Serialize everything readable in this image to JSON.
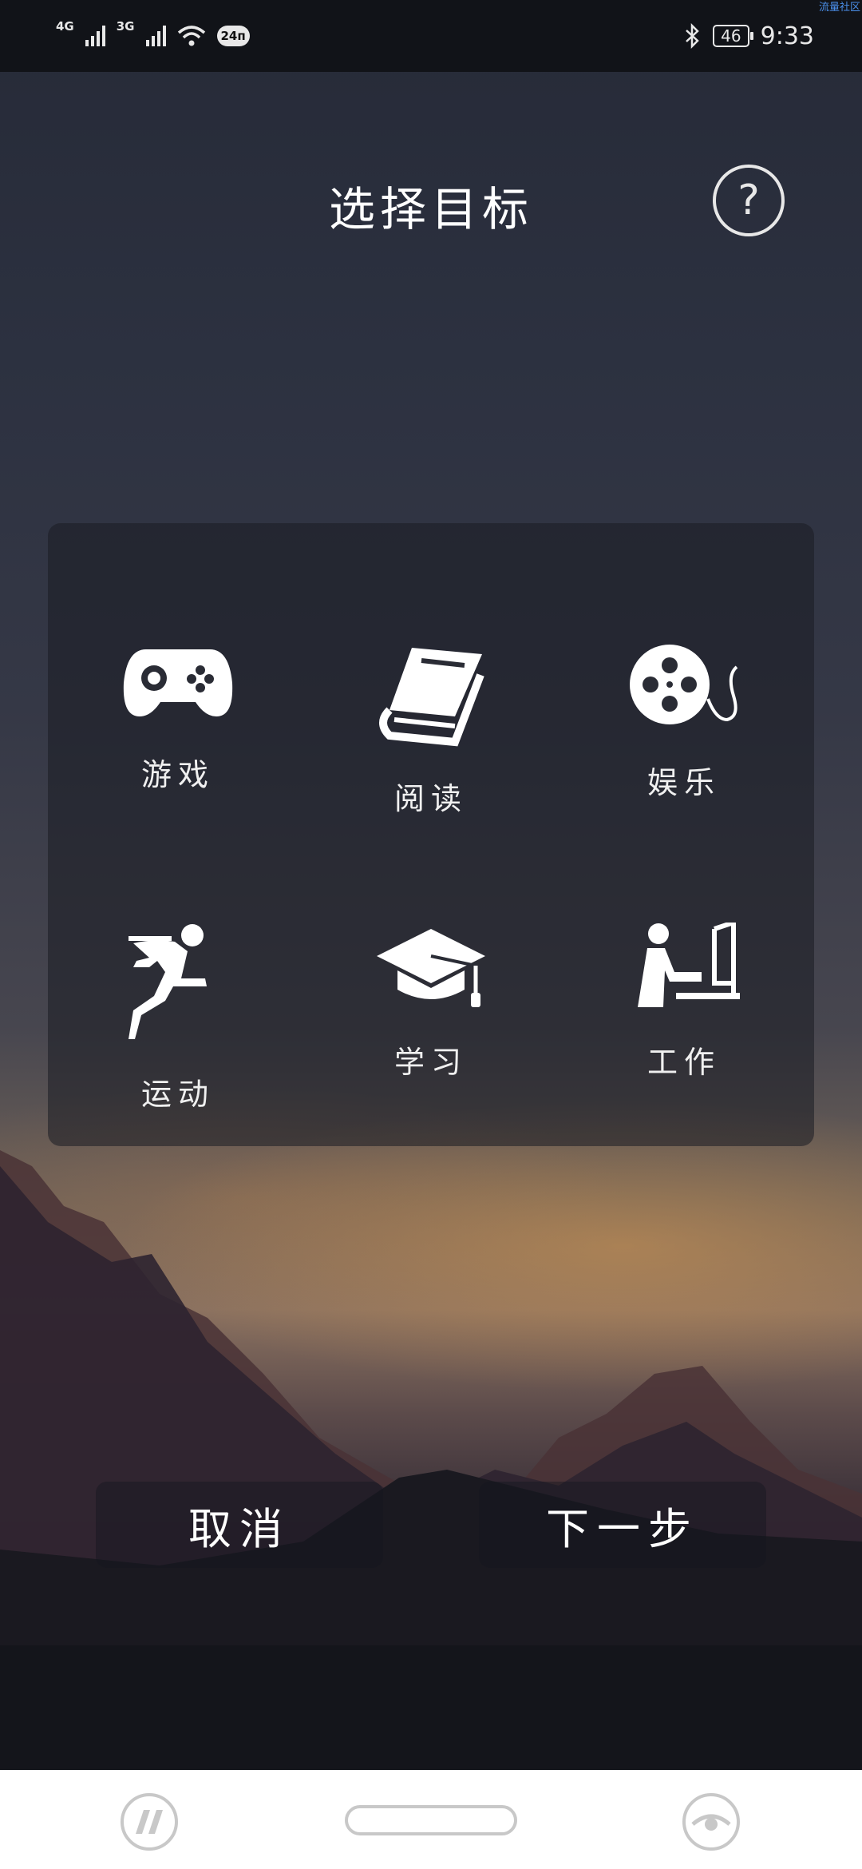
{
  "status_bar": {
    "network_1": "4G",
    "network_2": "3G",
    "data_badge": "24п",
    "battery": "46",
    "time": "9:33",
    "watermark": "流量社区"
  },
  "header": {
    "title": "选择目标",
    "help_icon": "question-circle-icon"
  },
  "goals": [
    {
      "label": "游戏",
      "icon": "gamepad-icon"
    },
    {
      "label": "阅读",
      "icon": "book-icon"
    },
    {
      "label": "娱乐",
      "icon": "film-reel-icon"
    },
    {
      "label": "运动",
      "icon": "runner-icon"
    },
    {
      "label": "学习",
      "icon": "graduation-cap-icon"
    },
    {
      "label": "工作",
      "icon": "person-at-desk-icon"
    }
  ],
  "actions": {
    "cancel_label": "取消",
    "next_label": "下一步"
  },
  "nav_bar": {
    "left_icon": "app-logo-icon",
    "center_icon": "home-pill",
    "right_icon": "eye-icon"
  },
  "colors": {
    "status_bar_bg": "#111318",
    "text": "#ffffff",
    "nav_bar_bg": "#ffffff",
    "nav_icon": "#c8c8c8"
  }
}
